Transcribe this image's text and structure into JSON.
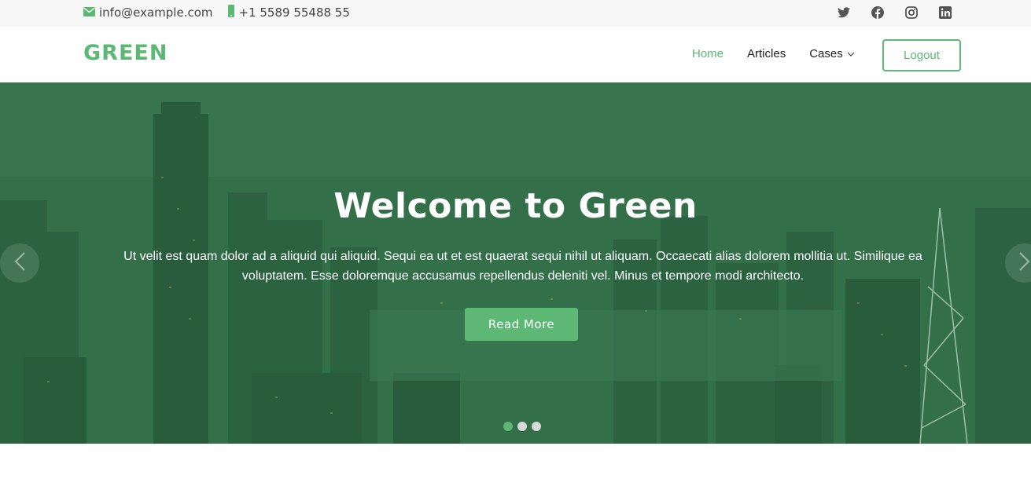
{
  "colors": {
    "accent": "#5cb874",
    "hero_overlay": "#2f6b45",
    "topbar_bg": "#f7f7f7"
  },
  "topbar": {
    "email": "info@example.com",
    "phone": "+1 5589 55488 55",
    "email_icon": "envelope-icon",
    "phone_icon": "phone-icon",
    "social": [
      "twitter-icon",
      "facebook-icon",
      "instagram-icon",
      "linkedin-icon"
    ]
  },
  "header": {
    "logo": "GREEN",
    "nav": [
      {
        "label": "Home",
        "active": true
      },
      {
        "label": "Articles",
        "active": false
      },
      {
        "label": "Cases",
        "active": false,
        "dropdown": true
      }
    ],
    "logout_label": "Logout"
  },
  "hero": {
    "title": "Welcome to Green",
    "text": "Ut velit est quam dolor ad a aliquid qui aliquid. Sequi ea ut et est quaerat sequi nihil ut aliquam. Occaecati alias dolorem mollitia ut. Similique ea voluptatem. Esse doloremque accusamus repellendus deleniti vel. Minus et tempore modi architecto.",
    "button_label": "Read More",
    "slides": 3,
    "active_slide": 1
  }
}
